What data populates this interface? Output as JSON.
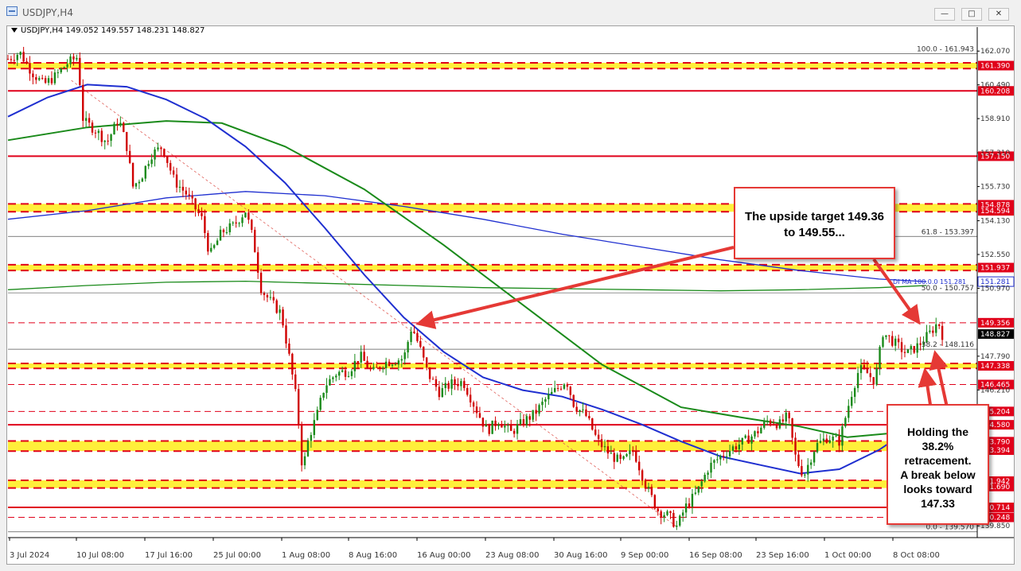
{
  "window": {
    "title": "USDJPY,H4",
    "symbol_info": "USDJPY,H4  149.052 149.557 148.231 148.827"
  },
  "colors": {
    "bull_candle": "#1a8a1a",
    "bear_candle": "#d00000",
    "ma_short": "#1f2fd0",
    "ma_long": "#1a8a1a",
    "resistance_line": "#e0001a",
    "zone_fill": "#ffef3a",
    "annotation": "#e53935",
    "fib_line": "#555555"
  },
  "annotations": {
    "top_lines": [
      "The upside target 149.36",
      "to 149.55..."
    ],
    "bottom_lines": [
      "Holding the",
      "38.2%",
      "retracement.",
      "A break below",
      "looks toward",
      "147.33"
    ]
  },
  "chart_data": {
    "type": "candlestick",
    "title": "USDJPY,H4",
    "ohlc_readout": {
      "open": 149.052,
      "high": 149.557,
      "low": 148.231,
      "close": 148.827
    },
    "x_ticks": [
      "3 Jul 2024",
      "10 Jul 08:00",
      "17 Jul 16:00",
      "25 Jul 00:00",
      "1 Aug 08:00",
      "8 Aug 16:00",
      "16 Aug 00:00",
      "23 Aug 08:00",
      "30 Aug 16:00",
      "9 Sep 00:00",
      "16 Sep 08:00",
      "23 Sep 16:00",
      "1 Oct 00:00",
      "8 Oct 08:00"
    ],
    "y_ticks": [
      "162.070",
      "160.490",
      "158.910",
      "157.310",
      "155.730",
      "154.130",
      "152.550",
      "150.970",
      "147.790",
      "146.210",
      "139.850"
    ],
    "ylim": [
      139.3,
      162.6
    ],
    "price_labels": [
      {
        "text": "161.390",
        "value": 161.39,
        "style": "zone"
      },
      {
        "text": "160.208",
        "value": 160.208,
        "style": "red"
      },
      {
        "text": "157.150",
        "value": 157.15,
        "style": "red"
      },
      {
        "text": "154.878",
        "value": 154.878,
        "style": "zone"
      },
      {
        "text": "154.594",
        "value": 154.594,
        "style": "zone"
      },
      {
        "text": "151.937",
        "value": 151.937,
        "style": "zone"
      },
      {
        "text": "151.281",
        "value": 151.281,
        "style": "ma"
      },
      {
        "text": "149.356",
        "value": 149.356,
        "style": "red"
      },
      {
        "text": "148.827",
        "value": 148.827,
        "style": "current"
      },
      {
        "text": "147.338",
        "value": 147.338,
        "style": "red"
      },
      {
        "text": "146.465",
        "value": 146.465,
        "style": "red"
      },
      {
        "text": "145.204",
        "value": 145.204,
        "style": "red"
      },
      {
        "text": "144.580",
        "value": 144.58,
        "style": "red"
      },
      {
        "text": "143.790",
        "value": 143.79,
        "style": "red"
      },
      {
        "text": "143.394",
        "value": 143.394,
        "style": "red"
      },
      {
        "text": "141.942",
        "value": 141.942,
        "style": "red"
      },
      {
        "text": "141.690",
        "value": 141.69,
        "style": "red"
      },
      {
        "text": "140.714",
        "value": 140.714,
        "style": "red"
      },
      {
        "text": "140.248",
        "value": 140.248,
        "style": "red"
      }
    ],
    "fib_levels": [
      {
        "label": "100.0 - 161.943",
        "value": 161.943
      },
      {
        "label": "61.8 - 153.397",
        "value": 153.397
      },
      {
        "label": "50.0 - 150.757",
        "value": 150.757
      },
      {
        "label": "38.2 - 148.116",
        "value": 148.116
      },
      {
        "label": "0.0 - 139.570",
        "value": 139.57
      }
    ],
    "ma_overlay_label": "DI MA 100.0.0 151.281",
    "zones": [
      [
        161.25,
        161.52
      ],
      [
        154.55,
        154.92
      ],
      [
        151.8,
        152.07
      ],
      [
        147.22,
        147.45
      ],
      [
        143.35,
        143.82
      ],
      [
        141.62,
        141.98
      ]
    ],
    "red_lines": [
      160.208,
      157.15,
      149.356,
      146.465,
      145.204,
      144.58,
      140.714,
      140.248
    ],
    "resistance_lines_solid": [
      160.208,
      157.15,
      144.58,
      140.714
    ],
    "trendline": {
      "from": [
        0.08,
        160.7
      ],
      "to": [
        0.845,
        139.8
      ]
    },
    "price_path": [
      [
        0.0,
        161.7
      ],
      [
        0.015,
        162.0
      ],
      [
        0.03,
        161.1
      ],
      [
        0.045,
        160.5
      ],
      [
        0.06,
        160.9
      ],
      [
        0.075,
        161.5
      ],
      [
        0.088,
        161.8
      ],
      [
        0.095,
        158.8
      ],
      [
        0.11,
        158.4
      ],
      [
        0.125,
        157.8
      ],
      [
        0.14,
        158.9
      ],
      [
        0.15,
        157.6
      ],
      [
        0.158,
        155.7
      ],
      [
        0.17,
        156.3
      ],
      [
        0.18,
        157.2
      ],
      [
        0.195,
        157.6
      ],
      [
        0.21,
        156.0
      ],
      [
        0.225,
        155.4
      ],
      [
        0.245,
        154.2
      ],
      [
        0.255,
        152.5
      ],
      [
        0.27,
        153.6
      ],
      [
        0.285,
        153.9
      ],
      [
        0.3,
        154.6
      ],
      [
        0.31,
        153.2
      ],
      [
        0.32,
        150.9
      ],
      [
        0.335,
        150.2
      ],
      [
        0.345,
        149.8
      ],
      [
        0.355,
        147.8
      ],
      [
        0.365,
        145.6
      ],
      [
        0.372,
        142.4
      ],
      [
        0.38,
        144.0
      ],
      [
        0.39,
        145.0
      ],
      [
        0.4,
        146.4
      ],
      [
        0.415,
        147.0
      ],
      [
        0.43,
        147.1
      ],
      [
        0.445,
        147.8
      ],
      [
        0.46,
        147.0
      ],
      [
        0.475,
        147.5
      ],
      [
        0.49,
        147.6
      ],
      [
        0.5,
        147.7
      ],
      [
        0.51,
        149.2
      ],
      [
        0.52,
        148.2
      ],
      [
        0.53,
        147.0
      ],
      [
        0.545,
        146.1
      ],
      [
        0.56,
        146.5
      ],
      [
        0.575,
        146.6
      ],
      [
        0.59,
        145.4
      ],
      [
        0.605,
        144.3
      ],
      [
        0.62,
        144.8
      ],
      [
        0.635,
        144.2
      ],
      [
        0.65,
        144.7
      ],
      [
        0.665,
        145.1
      ],
      [
        0.68,
        145.8
      ],
      [
        0.695,
        146.3
      ],
      [
        0.705,
        146.7
      ],
      [
        0.715,
        145.5
      ],
      [
        0.73,
        145.0
      ],
      [
        0.745,
        143.8
      ],
      [
        0.76,
        143.2
      ],
      [
        0.775,
        142.8
      ],
      [
        0.79,
        143.4
      ],
      [
        0.805,
        141.8
      ],
      [
        0.82,
        140.6
      ],
      [
        0.835,
        140.3
      ],
      [
        0.845,
        139.8
      ],
      [
        0.855,
        140.7
      ],
      [
        0.87,
        141.4
      ],
      [
        0.885,
        142.6
      ],
      [
        0.9,
        143.1
      ],
      [
        0.915,
        143.5
      ],
      [
        0.93,
        143.8
      ],
      [
        0.945,
        144.2
      ],
      [
        0.96,
        144.8
      ],
      [
        0.975,
        144.6
      ],
      [
        0.985,
        145.0
      ],
      [
        0.995,
        143.0
      ],
      [
        1.005,
        142.2
      ],
      [
        1.02,
        143.6
      ],
      [
        1.035,
        144.0
      ],
      [
        1.05,
        143.8
      ],
      [
        1.065,
        146.0
      ],
      [
        1.075,
        147.2
      ],
      [
        1.085,
        147.0
      ],
      [
        1.095,
        146.6
      ],
      [
        1.105,
        148.9
      ],
      [
        1.12,
        148.4
      ],
      [
        1.135,
        147.9
      ],
      [
        1.15,
        148.3
      ],
      [
        1.165,
        148.9
      ],
      [
        1.175,
        149.4
      ],
      [
        1.18,
        148.8
      ]
    ],
    "ma_short_path": [
      [
        0.0,
        159.0
      ],
      [
        0.05,
        159.9
      ],
      [
        0.1,
        160.5
      ],
      [
        0.15,
        160.4
      ],
      [
        0.2,
        159.8
      ],
      [
        0.25,
        158.9
      ],
      [
        0.3,
        157.6
      ],
      [
        0.35,
        155.9
      ],
      [
        0.4,
        153.8
      ],
      [
        0.45,
        151.6
      ],
      [
        0.5,
        149.6
      ],
      [
        0.55,
        148.0
      ],
      [
        0.6,
        146.8
      ],
      [
        0.65,
        146.2
      ],
      [
        0.7,
        145.9
      ],
      [
        0.75,
        145.3
      ],
      [
        0.8,
        144.6
      ],
      [
        0.85,
        143.8
      ],
      [
        0.9,
        143.1
      ],
      [
        0.95,
        142.7
      ],
      [
        1.0,
        142.3
      ],
      [
        1.05,
        142.5
      ],
      [
        1.1,
        143.4
      ],
      [
        1.12,
        143.9
      ]
    ],
    "ma_long_path": [
      [
        0.0,
        157.9
      ],
      [
        0.1,
        158.5
      ],
      [
        0.2,
        158.8
      ],
      [
        0.27,
        158.7
      ],
      [
        0.35,
        157.6
      ],
      [
        0.45,
        155.6
      ],
      [
        0.55,
        153.0
      ],
      [
        0.65,
        150.2
      ],
      [
        0.75,
        147.4
      ],
      [
        0.85,
        145.4
      ],
      [
        0.93,
        144.9
      ],
      [
        1.0,
        144.5
      ],
      [
        1.06,
        144.0
      ],
      [
        1.12,
        144.2
      ]
    ],
    "ma_blue_long_path": [
      [
        0.0,
        154.2
      ],
      [
        0.1,
        154.6
      ],
      [
        0.2,
        155.2
      ],
      [
        0.3,
        155.5
      ],
      [
        0.4,
        155.3
      ],
      [
        0.5,
        154.8
      ],
      [
        0.6,
        154.2
      ],
      [
        0.7,
        153.5
      ],
      [
        0.8,
        152.9
      ],
      [
        0.9,
        152.3
      ],
      [
        1.0,
        151.8
      ],
      [
        1.1,
        151.4
      ],
      [
        1.16,
        151.28
      ]
    ],
    "ma_green_long_path": [
      [
        0.0,
        150.9
      ],
      [
        0.1,
        151.1
      ],
      [
        0.2,
        151.25
      ],
      [
        0.3,
        151.3
      ],
      [
        0.4,
        151.2
      ],
      [
        0.5,
        151.1
      ],
      [
        0.6,
        151.0
      ],
      [
        0.7,
        150.95
      ],
      [
        0.8,
        150.9
      ],
      [
        0.9,
        150.85
      ],
      [
        1.0,
        150.9
      ],
      [
        1.1,
        151.0
      ],
      [
        1.16,
        151.1
      ]
    ]
  }
}
